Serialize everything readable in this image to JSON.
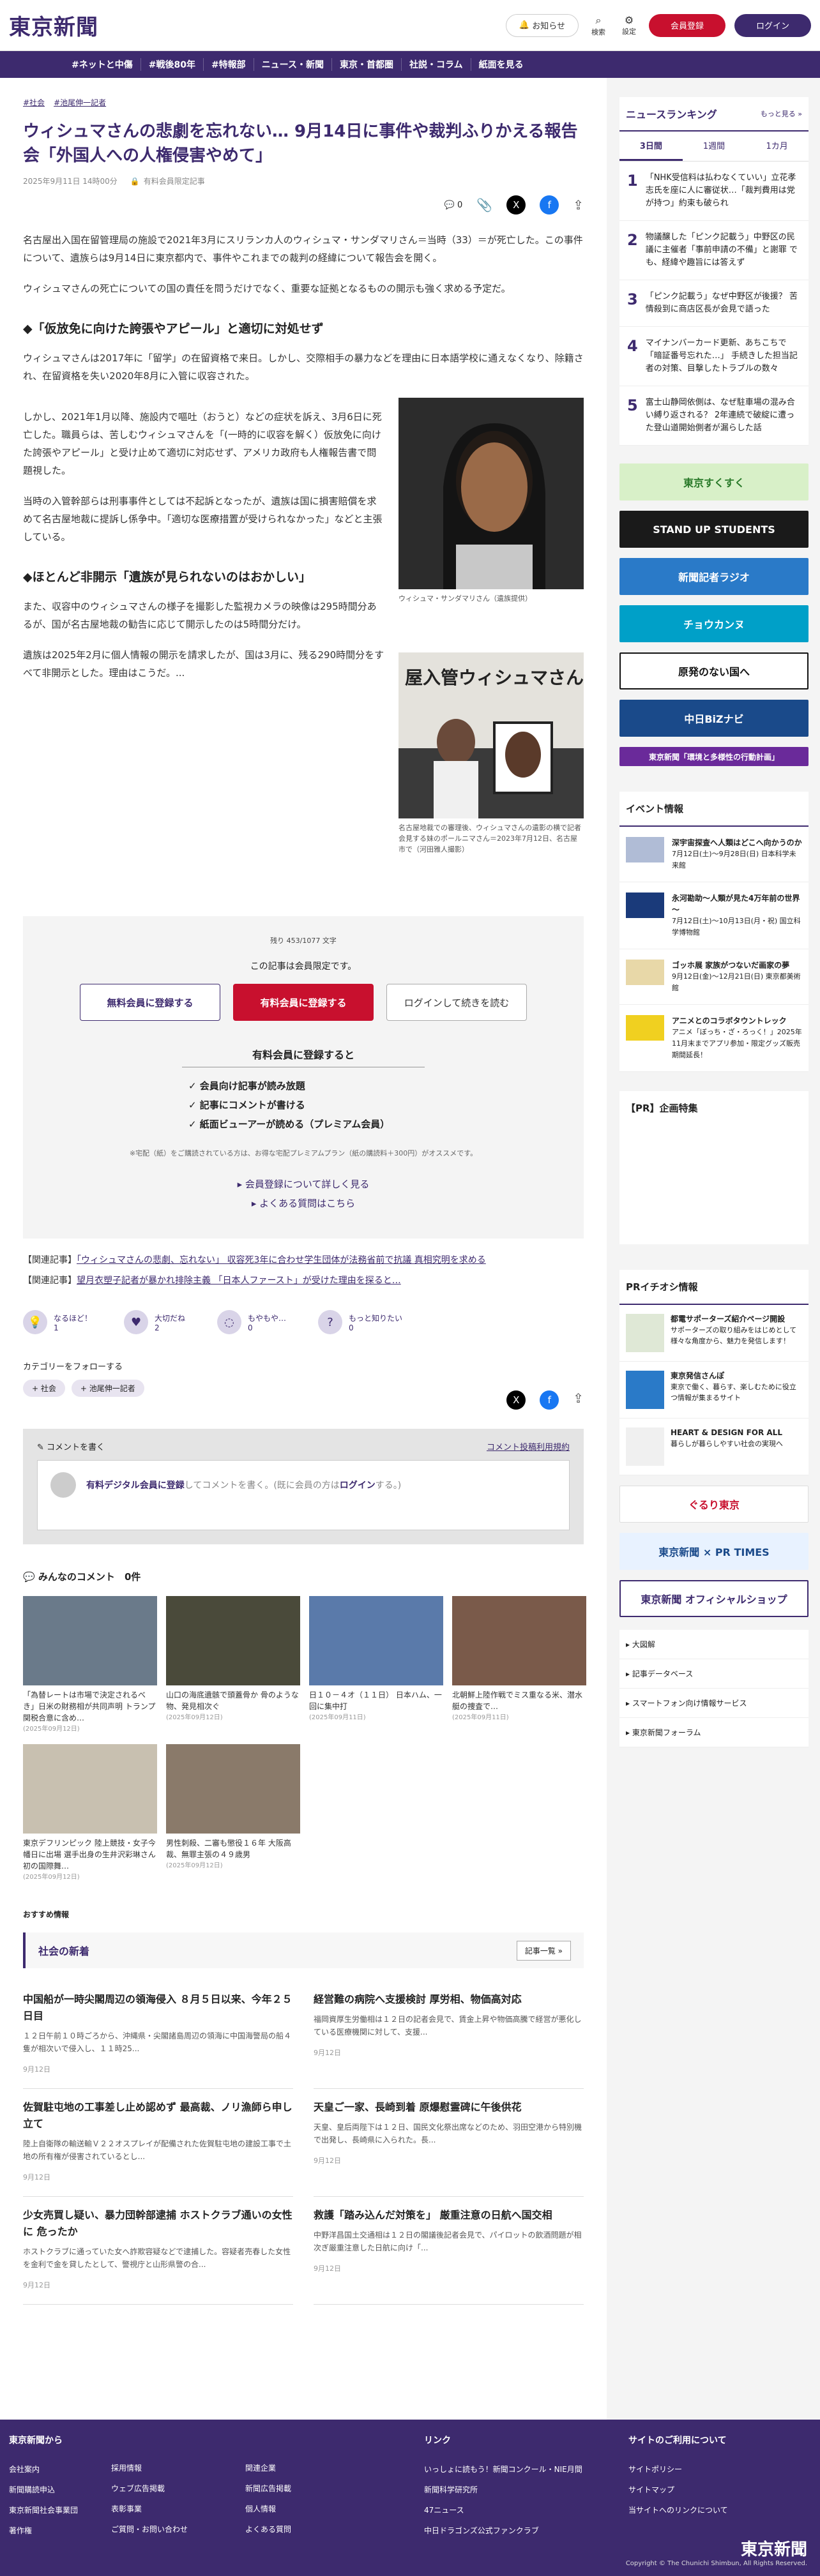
{
  "header": {
    "logo": "東京新聞",
    "notice": "お知らせ",
    "search": "検索",
    "settings": "設定",
    "register": "会員登録",
    "login": "ログイン"
  },
  "nav": [
    "#ネットと中傷",
    "#戦後80年",
    "#特報部",
    "ニュース・新聞",
    "東京・首都圏",
    "社説・コラム",
    "紙面を見る"
  ],
  "article": {
    "tags": [
      "#社会",
      "#池尾伸一記者"
    ],
    "title": "ウィシュマさんの悲劇を忘れない… 9月14日に事件や裁判ふりかえる報告会「外国人への人権侵害やめて」",
    "date": "2025年9月11日 14時00分",
    "members_only": "有料会員限定記事",
    "comment_count": "0",
    "p1": "名古屋出入国在留管理局の施設で2021年3月にスリランカ人のウィシュマ・サンダマリさん＝当時（33）＝が死亡した。この事件について、遺族らは9月14日に東京都内で、事件やこれまでの裁判の経緯について報告会を開く。",
    "p2": "ウィシュマさんの死亡についての国の責任を問うだけでなく、重要な証拠となるものの開示も強く求める予定だ。",
    "h2a": "◆「仮放免に向けた誇張やアピール」と適切に対処せず",
    "p3": "ウィシュマさんは2017年に「留学」の在留資格で来日。しかし、交際相手の暴力などを理由に日本語学校に通えなくなり、除籍され、在留資格を失い2020年8月に入管に収容された。",
    "p4": "しかし、2021年1月以降、施設内で嘔吐（おうと）などの症状を訴え、3月6日に死亡した。職員らは、苦しむウィシュマさんを「(一時的に収容を解く）仮放免に向けた誇張やアピール」と受け止めて適切に対応せず、アメリカ政府も人権報告書で問題視した。",
    "p5": "当時の入管幹部らは刑事事件としては不起訴となったが、遺族は国に損害賠償を求めて名古屋地裁に提訴し係争中。「適切な医療措置が受けられなかった」などと主張している。",
    "h2b": "◆ほとんど非開示「遺族が見られないのはおかしい」",
    "p6": "また、収容中のウィシュマさんの様子を撮影した監視カメラの映像は295時間分あるが、国が名古屋地裁の勧告に応じて開示したのは5時間分だけ。",
    "p7": "遺族は2025年2月に個人情報の開示を請求したが、国は3月に、残る290時間分をすべて非開示とした。理由はこうだ。...",
    "cap1": "ウィシュマ・サンダマリさん（遺族提供）",
    "cap2": "名古屋地裁での審理後、ウィシュマさんの遺影の横で記者会見する妹のポールニマさん＝2023年7月12日、名古屋市で（河田雅人撮影）",
    "photo2_text": "屋入管ウィシュマさん"
  },
  "paywall": {
    "remain": "残り 453/1077 文字",
    "limited": "この記事は会員限定です。",
    "free": "無料会員に登録する",
    "paid": "有料会員に登録する",
    "login": "ログインして続きを読む",
    "benefit_title": "有料会員に登録すると",
    "benefits": [
      "会員向け記事が読み放題",
      "記事にコメントが書ける",
      "紙面ビューアーが読める（プレミアム会員）"
    ],
    "note": "※宅配（紙）をご購読されている方は、お得な宅配プレミアムプラン（紙の購読料＋300円）がオススメです。",
    "link1": "会員登録について詳しく見る",
    "link2": "よくある質問はこちら"
  },
  "related": [
    {
      "k": "【関連記事】",
      "t": "「ウィシュマさんの悲劇、忘れない」 収容死3年に合わせ学生団体が法務省前で抗議 真相究明を求める"
    },
    {
      "k": "【関連記事】",
      "t": "望月衣塑子記者が暴かれ排除主義 「日本人ファースト」が受けた理由を探ると…"
    }
  ],
  "reactions": [
    {
      "l": "なるほど！",
      "n": "1",
      "i": "💡"
    },
    {
      "l": "大切だね",
      "n": "2",
      "i": "♥"
    },
    {
      "l": "もやもや…",
      "n": "0",
      "i": "◌"
    },
    {
      "l": "もっと知りたい",
      "n": "0",
      "i": "?"
    }
  ],
  "category": {
    "label": "カテゴリーをフォローする",
    "chips": [
      "+ 社会",
      "+ 池尾伸一記者"
    ]
  },
  "comment": {
    "write": "コメントを書く",
    "rules": "コメント投稿利用規約",
    "placeholder_link": "有料デジタル会員に登録",
    "placeholder_rest": "してコメントを書く。(既に会員の方は",
    "login": "ログイン",
    "end": "する。)",
    "all": "みんなのコメント",
    "count": "0件"
  },
  "thumbs": [
    {
      "t": "「為替レートは市場で決定されるべき」日米の財務相が共同声明 トランプ関税合意に含め…",
      "d": "(2025年09月12日)"
    },
    {
      "t": "山口の海底遺骸で頭蓋骨か 骨のような物、発見相次ぐ",
      "d": "(2025年09月12日)"
    },
    {
      "t": "日１０－４オ（１１日） 日本ハム、一回に集中打",
      "d": "(2025年09月11日)"
    },
    {
      "t": "北朝鮮上陸作戦でミス重なる米、潜水艇の捜査で…",
      "d": "(2025年09月11日)"
    },
    {
      "t": "東京デフリンピック 陸上競技・女子今幡日に出場 選手出身の生井沢彩琳さん 初の国際舞…",
      "d": "(2025年09月12日)"
    },
    {
      "t": "男性刺殺、二審も懲役１６年 大阪高裁、無罪主張の４９歳男",
      "d": "(2025年09月12日)"
    }
  ],
  "osusume": "おすすめ情報",
  "news": {
    "title": "社会の新着",
    "more": "記事一覧 »",
    "items": [
      {
        "t": "中国船が一時尖閣周辺の領海侵入 ８月５日以来、今年２５日目",
        "s": "１２日午前１０時ごろから、沖縄県・尖閣諸島周辺の領海に中国海警局の船４隻が相次いで侵入し、１１時25...",
        "d": "9月12日"
      },
      {
        "t": "経営難の病院へ支援検討 厚労相、物価高対応",
        "s": "福岡資厚生労働相は１２日の記者会見で、賃金上昇や物価高騰で経営が悪化している医療機関に対して、支援...",
        "d": "9月12日"
      },
      {
        "t": "佐賀駐屯地の工事差し止め認めず 最高裁、ノリ漁師ら申し立て",
        "s": "陸上自衛隊の輸送輸Ｖ２２オスプレイが配備された佐賀駐屯地の建設工事で土地の所有権が侵害されているとし...",
        "d": "9月12日"
      },
      {
        "t": "天皇ご一家、長崎到着 原爆慰霊碑に午後供花",
        "s": "天皇、皇后両陛下は１２日、国民文化祭出席などのため、羽田空港から特別機で出発し、長崎県に入られた。長...",
        "d": "9月12日"
      },
      {
        "t": "少女売買し疑い、暴力団幹部逮捕 ホストクラブ通いの女性に 危ったか",
        "s": "ホストクラブに通っていた女へ詐欺容疑などで逮捕した。容疑者売春した女性を金利で金を貸したとして、警視庁と山形県警の合...",
        "d": "9月12日"
      },
      {
        "t": "救護「踏み込んだ対策を」 厳重注意の日航へ国交相",
        "s": "中野洋昌国土交通相は１２日の閣議後記者会見で、パイロットの飲酒問題が相次ぎ厳重注意した日航に向け「...",
        "d": "9月12日"
      }
    ]
  },
  "ranking": {
    "title": "ニュースランキング",
    "more": "もっと見る »",
    "tabs": [
      "3日間",
      "1週間",
      "1カ月"
    ],
    "items": [
      "「NHK受信料は払わなくていい」立花孝志氏を座に人に審従状…「裁判費用は党が持つ」約束も破られ",
      "物議醸した「ピンク記載う」中野区の民議に主催者「事前申請の不備」と謝罪 でも、経緯や趣旨には答えず",
      "「ピンク記載う」なぜ中野区が後援？ 苦情殺到に商店区長が会見で語った",
      "マイナンバーカード更新、あちこちで「暗証番号忘れた…」 手続きした担当記者の対策、目撃したトラブルの数々",
      "富士山静岡依側は、なぜ駐車場の混み合い縛り返される？ 2年連続で破綻に遭った登山道開始側者が漏らした話"
    ]
  },
  "banners": [
    {
      "t": "東京すくすく",
      "bg": "#d8f0c8",
      "c": "#2a7a2a"
    },
    {
      "t": "STAND UP STUDENTS",
      "bg": "#1a1a1a",
      "c": "#fff"
    },
    {
      "t": "新聞記者ラジオ",
      "bg": "#2a7ac8",
      "c": "#fff"
    },
    {
      "t": "チョウカンヌ",
      "bg": "#00a0c8",
      "c": "#fff"
    },
    {
      "t": "原発のない国へ",
      "bg": "#fff",
      "c": "#111"
    },
    {
      "t": "中日BiZナビ",
      "bg": "#1a4a8a",
      "c": "#fff"
    },
    {
      "t": "東京新聞「環境と多様性の行動計画」",
      "bg": "#6a2a9a",
      "c": "#fff"
    }
  ],
  "events": {
    "title": "イベント情報",
    "items": [
      {
        "t": "深宇宙探査へ人類はどこへ向かうのか",
        "s": "7月12日(土)〜9月28日(日) 日本科学未来館"
      },
      {
        "t": "永河勘助～人類が見た4万年前の世界～",
        "s": "7月12日(土)〜10月13日(月・祝) 国立科学博物館"
      },
      {
        "t": "ゴッホ展 家族がつないだ画家の夢",
        "s": "9月12日(金)〜12月21日(日) 東京都美術館"
      },
      {
        "t": "アニメとのコラボタウントレック",
        "s": "アニメ「ぼっち・ざ・ろっく！」2025年11月末までアプリ参加・限定グッズ販売 期間延長！"
      }
    ]
  },
  "pr_title": "【PR】企画特集",
  "pr_info": {
    "title": "PRイチオシ情報",
    "items": [
      {
        "t": "都電サポーターズ紹介ページ開設",
        "s": "サポーターズの取り組みをはじめとして様々な角度から、魅力を発信します！"
      },
      {
        "t": "東京発信さんぽ",
        "s": "東京で働く、暮らす、楽しむために役立つ情報が集まるサイト"
      },
      {
        "t": "HEART & DESIGN FOR ALL",
        "s": "暮らしが暮らしやすい社会の実現へ"
      }
    ]
  },
  "banners2": [
    {
      "t": "ぐるり東京",
      "bg": "#fff",
      "c": "#c8102e"
    },
    {
      "t": "東京新聞 × PR TIMES",
      "bg": "#e8f2ff",
      "c": "#1a4a8a"
    },
    {
      "t": "東京新聞 オフィシャルショップ",
      "bg": "#fff",
      "c": "#3d2a6e"
    }
  ],
  "side_links": [
    "大図解",
    "記事データベース",
    "スマートフォン向け情報サービス",
    "東京新聞フォーラム"
  ],
  "footer": {
    "c1": {
      "h": "東京新聞から",
      "l": [
        "会社案内",
        "新聞購読申込",
        "東京新聞社会事業団",
        "著作権"
      ]
    },
    "c2": {
      "h": "",
      "l": [
        "採用情報",
        "ウェブ広告掲載",
        "表彰事業",
        "ご質問・お問い合わせ"
      ]
    },
    "c3": {
      "h": "",
      "l": [
        "関連企業",
        "新聞広告掲載",
        "個人情報",
        "よくある質問"
      ]
    },
    "c4": {
      "h": "リンク",
      "l": [
        "いっしょに読もう！新聞コンクール・NIE月間",
        "新聞科学研究所",
        "47ニュース",
        "中日ドラゴンズ公式ファンクラブ"
      ]
    },
    "c5": {
      "h": "サイトのご利用について",
      "l": [
        "サイトポリシー",
        "サイトマップ",
        "当サイトへのリンクについて"
      ]
    },
    "copy": "Copyright © The Chunichi Shimbun, All Rights Reserved."
  }
}
